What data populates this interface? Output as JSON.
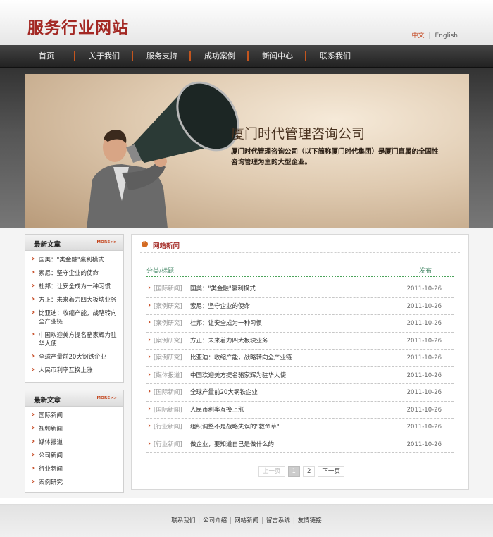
{
  "header": {
    "logo": "服务行业网站",
    "lang_cn": "中文",
    "lang_sep": "|",
    "lang_en": "English"
  },
  "nav": [
    "首页",
    "关于我们",
    "服务支持",
    "成功案例",
    "新闻中心",
    "联系我们"
  ],
  "banner": {
    "title": "厦门时代管理咨询公司",
    "desc": "厦门时代管理咨询公司（以下简称厦门时代集团）是厦门直属的全国性咨询管理为主的大型企业。"
  },
  "sidebar1": {
    "title": "最新文章",
    "more": "MORE>>",
    "items": [
      "国美：\"类金融\"赢利模式",
      "索尼：坚守企业的使命",
      "杜邦：让安全成为一种习惯",
      "方正：未来着力四大板块业务",
      "比亚迪：收缩产能，战略转向全产业链",
      "中国欢迎美方提名骆家辉为驻华大使",
      "全球产量前20大钢铁企业",
      "人民币利率互换上涨"
    ]
  },
  "sidebar2": {
    "title": "最新文章",
    "more": "MORE>>",
    "items": [
      "国际新闻",
      "视频新闻",
      "媒体报道",
      "公司新闻",
      "行业新闻",
      "案例研究"
    ]
  },
  "content": {
    "title": "网站新闻",
    "col_category": "分类/标题",
    "col_date": "发布",
    "rows": [
      {
        "cat": "[国际新闻]",
        "title": "国美：\"类金融\"赢利模式",
        "date": "2011-10-26"
      },
      {
        "cat": "[案例研究]",
        "title": "索尼：坚守企业的使命",
        "date": "2011-10-26"
      },
      {
        "cat": "[案例研究]",
        "title": "杜邦：让安全成为一种习惯",
        "date": "2011-10-26"
      },
      {
        "cat": "[案例研究]",
        "title": "方正：未来着力四大板块业务",
        "date": "2011-10-26"
      },
      {
        "cat": "[案例研究]",
        "title": "比亚迪：收缩产能，战略转向全产业链",
        "date": "2011-10-26"
      },
      {
        "cat": "[媒体报道]",
        "title": "中国欢迎美方提名骆家辉为驻华大使",
        "date": "2011-10-26"
      },
      {
        "cat": "[国际新闻]",
        "title": "全球产量前20大钢铁企业",
        "date": "2011-10-26"
      },
      {
        "cat": "[国际新闻]",
        "title": "人民币利率互换上涨",
        "date": "2011-10-26"
      },
      {
        "cat": "[行业新闻]",
        "title": "组织调整不是战略失误的\"救命草\"",
        "date": "2011-10-26"
      },
      {
        "cat": "[行业新闻]",
        "title": "做企业，要知道自己是做什么的",
        "date": "2011-10-26"
      }
    ],
    "pager": {
      "prev": "上一页",
      "pages": [
        "1",
        "2"
      ],
      "current": "1",
      "next": "下一页"
    }
  },
  "footer": {
    "links": [
      "联系我们",
      "公司介绍",
      "网站新闻",
      "留言系统",
      "友情链接"
    ]
  }
}
